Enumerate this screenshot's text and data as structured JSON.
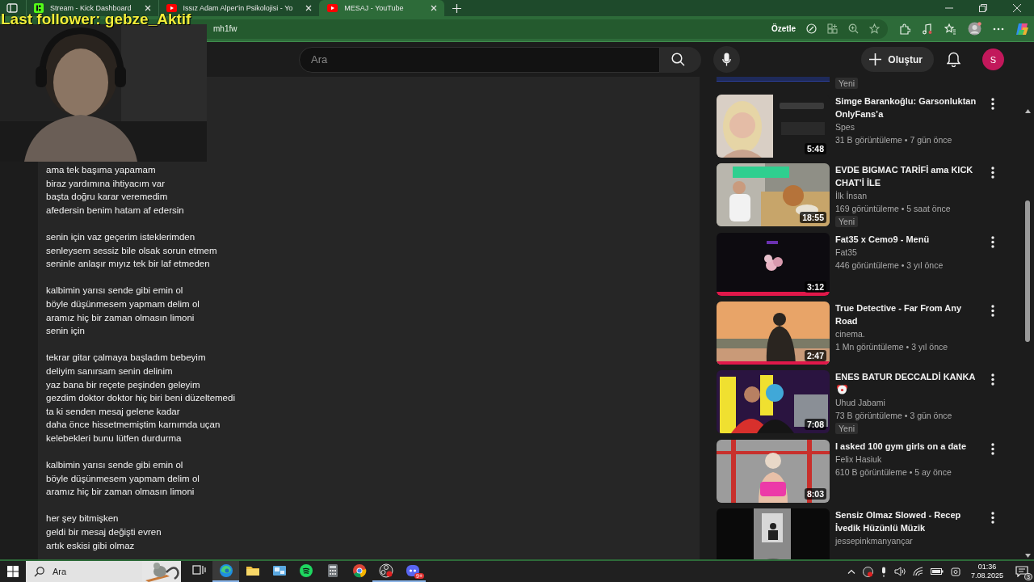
{
  "overlay": {
    "follower_text": "Last follower: gebze_Aktif",
    "kind": "picture"
  },
  "tabs": [
    {
      "title": "Stream - Kick Dashboard",
      "kind": "kick",
      "selected": false
    },
    {
      "title": "Issız Adam Alper'in Psikolojisi - Yo",
      "kind": "youtube",
      "selected": false
    },
    {
      "title": "MESAJ - YouTube",
      "kind": "youtube",
      "selected": true
    }
  ],
  "address_bar": {
    "url": "mh1fw",
    "summarize_button": "Özetle"
  },
  "header": {
    "search": {
      "placeholder": "Ara"
    },
    "create_button": "Oluştur",
    "avatar": "S"
  },
  "description": {
    "stanzas": [
      [
        "ama tek başıma yapamam",
        "biraz yardımına ihtiyacım var",
        "başta doğru karar veremedim",
        "afedersin benim hatam af edersin"
      ],
      [
        "senin için vaz geçerim isteklerimden",
        "senleysem sessiz bile olsak sorun etmem",
        "seninle anlaşır mıyız tek bir laf etmeden"
      ],
      [
        "kalbimin yarısı sende gibi emin ol",
        "böyle düşünmesem yapmam delim ol",
        "aramız hiç bir zaman olmasın limoni",
        "senin için"
      ],
      [
        "tekrar gitar çalmaya başladım bebeyim",
        "deliyim sanırsam senin delinim",
        "yaz bana bir reçete peşinden geleyim",
        "gezdim doktor doktor hiç biri beni düzeltemedi",
        "ta ki senden mesaj gelene kadar",
        "daha önce hissetmemiştim karnımda uçan",
        "kelebekleri bunu lütfen durdurma"
      ],
      [
        "kalbimin yarısı sende gibi emin ol",
        "böyle düşünmesem yapmam delim ol",
        "aramız hiç bir zaman olmasın limoni"
      ],
      [
        "her şey bitmişken",
        "geldi bir mesaj değişti evren",
        "artık eskisi gibi olmaz"
      ]
    ]
  },
  "recommendations": [
    {
      "kind": "partial",
      "badge": "Yeni"
    },
    {
      "kind": "video",
      "title": "Simge Barankoğlu: Garsonluktan OnlyFans’a",
      "channel": "Spes",
      "meta": "31 B görüntüleme • 7 gün önce",
      "duration": "5:48"
    },
    {
      "kind": "video",
      "title": "EVDE BIGMAC TARİFİ ama KICK CHAT’İ İLE",
      "channel": "İlk İnsan",
      "meta": "169 görüntüleme • 5 saat önce",
      "duration": "18:55",
      "badge": "Yeni"
    },
    {
      "kind": "video",
      "title": "Fat35 x Cemo9 - Menü",
      "channel": "Fat35",
      "meta": "446 görüntüleme • 3 yıl önce",
      "duration": "3:12"
    },
    {
      "kind": "video",
      "title": "True Detective - Far From Any Road",
      "channel": "cinema.",
      "meta": "1 Mn görüntüleme • 3 yıl önce",
      "duration": "2:47"
    },
    {
      "kind": "video",
      "title": "ENES BATUR DECCALDİ KANKA",
      "title_icon": {
        "kind": "clown"
      },
      "channel": "Uhud Jabami",
      "meta": "73 B görüntüleme • 3 gün önce",
      "duration": "7:08",
      "badge": "Yeni"
    },
    {
      "kind": "video",
      "title": "I asked 100 gym girls on a date",
      "channel": "Felix Hasiuk",
      "meta": "610 B görüntüleme • 5 ay önce",
      "duration": "8:03"
    },
    {
      "kind": "video",
      "title": "Sensiz Olmaz Slowed - Recep İvedik Hüzünlü Müzik",
      "channel": "jessepinkmanyançar"
    }
  ],
  "taskbar": {
    "search": {
      "placeholder": "Ara"
    },
    "apps": [
      {
        "kind": "taskview",
        "selected": false,
        "running": false
      },
      {
        "kind": "edge",
        "selected": true,
        "running": true
      },
      {
        "kind": "folder",
        "selected": false,
        "running": false
      },
      {
        "kind": "photos",
        "selected": false,
        "running": false
      },
      {
        "kind": "spotify",
        "selected": false,
        "running": false
      },
      {
        "kind": "calculator",
        "selected": false,
        "running": false
      },
      {
        "kind": "chrome",
        "selected": false,
        "running": false
      },
      {
        "kind": "obs",
        "selected": false,
        "running": true
      },
      {
        "kind": "discord",
        "selected": false,
        "running": true,
        "badge": "9+"
      }
    ],
    "clock": {
      "time": "01:36",
      "date": "7.08.2025"
    },
    "notifications": "3"
  }
}
